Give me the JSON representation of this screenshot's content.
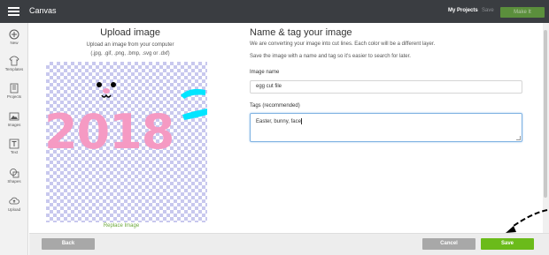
{
  "topbar": {
    "title": "Canvas",
    "my_projects": "My Projects",
    "save": "Save",
    "make_it": "Make It"
  },
  "sidebar": {
    "items": [
      {
        "label": "New",
        "icon": "plus-circle-icon"
      },
      {
        "label": "Templates",
        "icon": "shirt-icon"
      },
      {
        "label": "Projects",
        "icon": "projects-icon"
      },
      {
        "label": "Images",
        "icon": "image-icon"
      },
      {
        "label": "Text",
        "icon": "text-icon"
      },
      {
        "label": "Shapes",
        "icon": "shapes-icon"
      },
      {
        "label": "Upload",
        "icon": "upload-cloud-icon"
      }
    ]
  },
  "upload": {
    "title": "Upload image",
    "subtitle": "Upload an image from your computer",
    "extensions": "(.jpg, .gif, .png, .bmp, .svg or .dxf)",
    "preview_text": "2018",
    "replace": "Replace Image"
  },
  "form": {
    "title": "Name & tag your image",
    "desc1": "We are converting your image into cut lines. Each color will be a different layer.",
    "desc2": "Save the image with a name and tag so it's easier to search for later.",
    "name_label": "Image name",
    "name_value": "egg cut file",
    "tags_label": "Tags (recommended)",
    "tags_value": "Easter, bunny, face"
  },
  "footer": {
    "back": "Back",
    "cancel": "Cancel",
    "save": "Save"
  },
  "colors": {
    "topbar": "#3a3d41",
    "accent_green": "#6bbb1a",
    "preview_pink": "#f59ac3",
    "preview_cyan": "#00e5ff"
  }
}
